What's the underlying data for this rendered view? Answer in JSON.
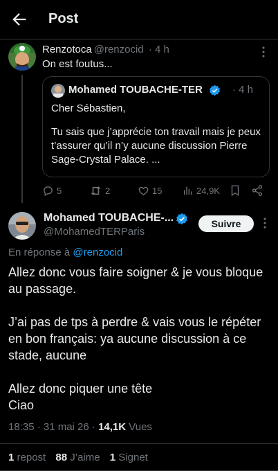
{
  "header": {
    "title": "Post"
  },
  "parent_post": {
    "author_name": "Renzotoca",
    "handle": "@renzocid",
    "time": "· 4 h",
    "text": "On est foutus...",
    "quote": {
      "author_name": "Mohamed TOUBACHE-TER",
      "time": "· 4 h",
      "greeting": "Cher Sébastien,",
      "body": "Tu sais que j’apprécie ton travail mais je peux t’assurer qu’il n’y aucune discussion Pierre Sage-Crystal Palace. ..."
    },
    "actions": {
      "replies": "5",
      "reposts": "2",
      "likes": "15",
      "views": "24,9K"
    }
  },
  "main_post": {
    "author_name": "Mohamed TOUBACHE-...",
    "handle": "@MohamedTERParis",
    "follow_label": "Suivre",
    "reply_prefix": "En réponse à",
    "reply_to": "@renzocid",
    "paragraphs": [
      "Allez donc vous faire soigner & je vous bloque au passage.",
      "J’ai pas de tps à perdre & vais vous le répéter en bon français: ya aucune discussion à ce stade, aucune",
      "Allez donc piquer une tête\nCiao"
    ],
    "timestamp": "18:35 · 31 mai 26 ·",
    "views_count": "14,1K",
    "views_label": "Vues",
    "stats": {
      "reposts_count": "1",
      "reposts_label": "repost",
      "likes_count": "88",
      "likes_label": "J’aime",
      "bookmarks_count": "1",
      "bookmarks_label": "Signet"
    }
  },
  "colors": {
    "background": "#000000",
    "text": "#e7e9ea",
    "muted": "#71767b",
    "accent": "#1d9bf0",
    "divider": "#2f3336"
  }
}
